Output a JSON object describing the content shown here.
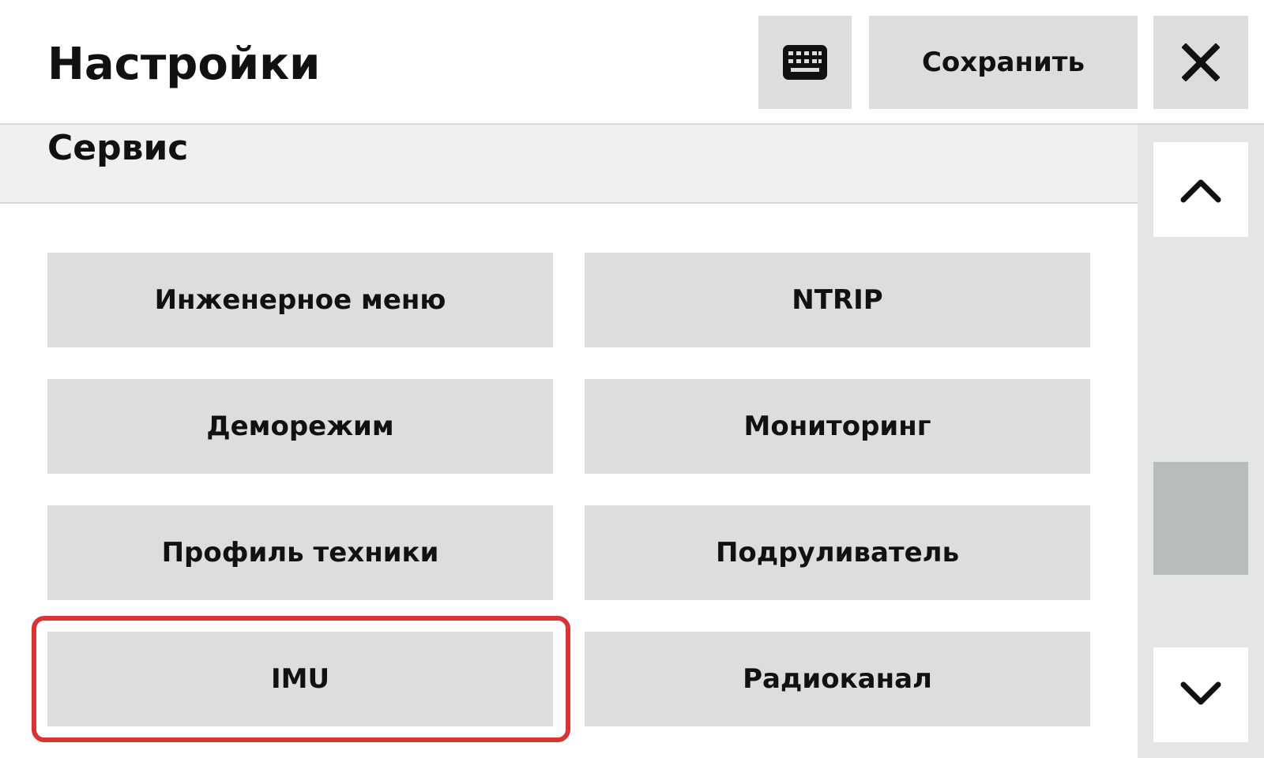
{
  "header": {
    "title": "Настройки",
    "keyboard_icon": "keyboard-icon",
    "save_label": "Сохранить",
    "close_icon": "close-icon"
  },
  "section": {
    "title": "Сервис"
  },
  "buttons": [
    {
      "label": "Инженерное меню"
    },
    {
      "label": "NTRIP"
    },
    {
      "label": "Деморежим"
    },
    {
      "label": "Мониторинг"
    },
    {
      "label": "Профиль техники"
    },
    {
      "label": "Подруливатель"
    },
    {
      "label": "IMU"
    },
    {
      "label": "Радиоканал"
    }
  ],
  "highlighted_button": "IMU",
  "scrollbar": {
    "up_icon": "chevron-up-icon",
    "down_icon": "chevron-down-icon"
  },
  "colors": {
    "button_bg": "#dcdedc",
    "highlight": "#d93434",
    "section_bg": "#f0f1ef",
    "scroll_thumb": "#b8bcbc"
  }
}
